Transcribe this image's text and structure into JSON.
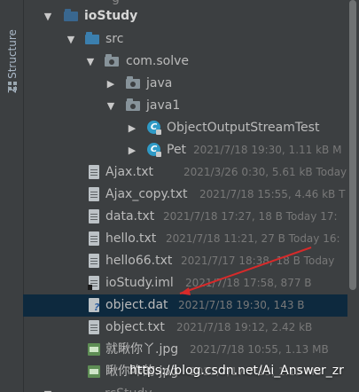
{
  "sidebar": {
    "structure_tab": "Z: Structure"
  },
  "tree": {
    "top_partial": "g",
    "project": "ioStudy",
    "src": "src",
    "package": "com.solve",
    "java_folder": "java",
    "java1_folder": "java1",
    "class_1": {
      "name": "ObjectOutputStreamTest",
      "meta": ""
    },
    "class_2": {
      "name": "Pet",
      "meta": "2021/7/18 19:30, 1.11 kB M"
    },
    "files": [
      {
        "name": "Ajax.txt",
        "meta": "2021/3/26 0:30, 5.61 kB Today 16"
      },
      {
        "name": "Ajax_copy.txt",
        "meta": "2021/7/18 15:55, 4.46 kB T"
      },
      {
        "name": "data.txt",
        "meta": "2021/7/18 17:27, 18 B Today 17:"
      },
      {
        "name": "hello.txt",
        "meta": "2021/7/18 11:21, 27 B Today 16:"
      },
      {
        "name": "hello66.txt",
        "meta": "2021/7/17 18:38, 18 B Today"
      },
      {
        "name": "ioStudy.iml",
        "meta": "2021/7/18 17:58, 877 B"
      },
      {
        "name": "object.dat",
        "meta": "2021/7/18 19:30, 143 B"
      },
      {
        "name": "object.txt",
        "meta": "2021/7/18 19:12, 2.42 kB"
      },
      {
        "name": "就瞅你丫.jpg",
        "meta": "2021/7/18 10:55, 1.13 MB"
      },
      {
        "name": "瞅你咋的.jpg",
        "meta": "2021/7/17 7:13, 1.13 MB"
      }
    ],
    "bottom_partial": "rcStudy"
  },
  "overlay": {
    "watermark": "https://blog.csdn.net/Ai_Answer_zr"
  },
  "colors": {
    "background": "#3c3f41",
    "selected_row": "#0d293e",
    "arrow_red": "#d62a2a",
    "class_icon": "#2f9ac6"
  },
  "icons": {
    "structure": "structure-icon",
    "project_folder": "project-folder-icon",
    "source_folder": "source-folder-icon",
    "package": "package-icon",
    "text_file": "text-file-icon",
    "unknown_file": "unknown-file-icon",
    "image_file": "image-file-icon",
    "class": "java-class-icon"
  }
}
